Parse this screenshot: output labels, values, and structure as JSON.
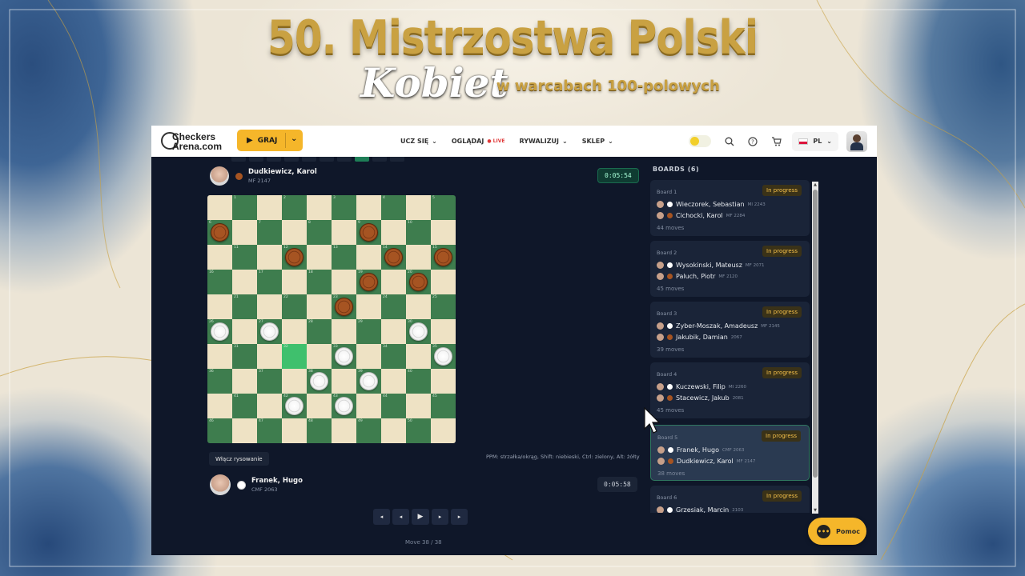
{
  "banner": {
    "title": "50. Mistrzostwa Polski",
    "kobiet": "Kobiet",
    "subtitle": "w warcabach 100-polowych"
  },
  "topbar": {
    "logo_line1": "Checkers",
    "logo_line2": "Arena.com",
    "play_label": "GRAJ",
    "nav": [
      {
        "label": "UCZ SIĘ"
      },
      {
        "label": "OGLĄDAJ",
        "badge": "LIVE"
      },
      {
        "label": "RYWALIZUJ"
      },
      {
        "label": "SKLEP"
      }
    ],
    "language": "PL"
  },
  "game": {
    "top_player": {
      "name": "Dudkiewicz, Karol",
      "rank": "MF 2147",
      "clock": "0:05:54",
      "color": "#a65422"
    },
    "bottom_player": {
      "name": "Franek, Hugo",
      "rank": "CMF 2063",
      "clock": "0:05:58",
      "color": "#ffffff"
    },
    "draw_button": "Włącz rysowanie",
    "hint": "PPM: strzałka/okrąg, Shift: niebieski, Ctrl: zielony, Alt: żółty",
    "move_counter": "Move 38 / 38",
    "highlight_square": 32,
    "black_pieces": [
      6,
      9,
      12,
      14,
      15,
      20,
      19,
      23
    ],
    "white_pieces": [
      26,
      27,
      30,
      33,
      35,
      38,
      39,
      43,
      42
    ],
    "square_numbers": [
      "1",
      "2",
      "3",
      "4",
      "5",
      "6",
      "7",
      "8",
      "9",
      "10",
      "11",
      "12",
      "13",
      "14",
      "15",
      "16",
      "17",
      "18",
      "19",
      "20",
      "21",
      "22",
      "23",
      "24",
      "25",
      "26",
      "27",
      "28",
      "29",
      "30",
      "31",
      "32",
      "33",
      "34",
      "35",
      "36",
      "37",
      "38",
      "39",
      "40",
      "41",
      "42",
      "43",
      "44",
      "45",
      "46",
      "47",
      "48",
      "49",
      "50"
    ]
  },
  "boards": {
    "title": "BOARDS (6)",
    "items": [
      {
        "board": "Board 1",
        "status": "In progress",
        "white": "Wieczorek, Sebastian",
        "white_rank": "MI 2243",
        "black": "Cichocki, Karol",
        "black_rank": "MF 2284",
        "moves": "44 moves"
      },
      {
        "board": "Board 2",
        "status": "In progress",
        "white": "Wysokinski, Mateusz",
        "white_rank": "MF 2071",
        "black": "Paluch, Piotr",
        "black_rank": "MF 2120",
        "moves": "45 moves"
      },
      {
        "board": "Board 3",
        "status": "In progress",
        "white": "Zyber-Moszak, Amadeusz",
        "white_rank": "MF 2145",
        "black": "Jakubik, Damian",
        "black_rank": "2067",
        "moves": "39 moves"
      },
      {
        "board": "Board 4",
        "status": "In progress",
        "white": "Kuczewski, Filip",
        "white_rank": "MI 2260",
        "black": "Stacewicz, Jakub",
        "black_rank": "2081",
        "moves": "45 moves"
      },
      {
        "board": "Board 5",
        "status": "In progress",
        "white": "Franek, Hugo",
        "white_rank": "CMF 2063",
        "black": "Dudkiewicz, Karol",
        "black_rank": "MF 2147",
        "moves": "38 moves"
      },
      {
        "board": "Board 6",
        "status": "In progress",
        "white": "Grzesiak, Marcin",
        "white_rank": "2103",
        "black": "",
        "black_rank": "",
        "moves": ""
      }
    ]
  },
  "help": {
    "label": "Pomoc"
  },
  "colors": {
    "accent": "#f5b62a",
    "board_dark": "#3e7d4e",
    "board_light": "#eee2c4",
    "highlight": "#3fc06d",
    "app_bg": "#0f1729"
  }
}
